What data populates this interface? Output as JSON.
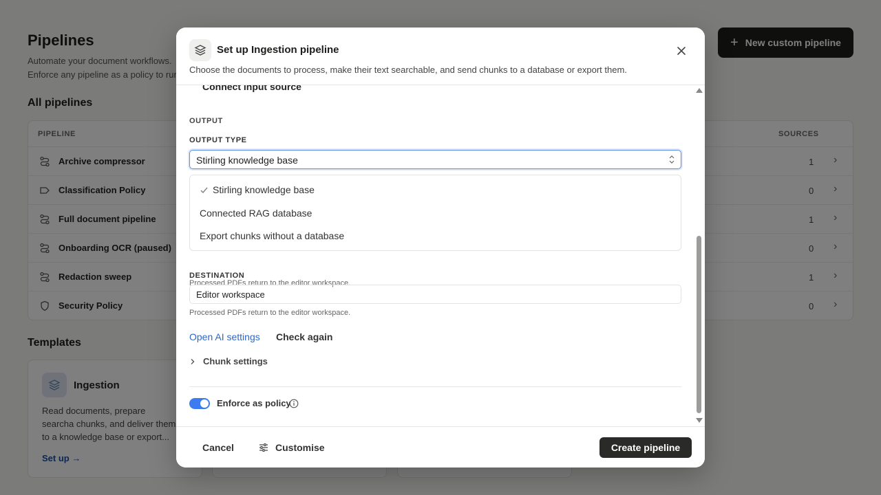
{
  "page": {
    "title": "Pipelines",
    "subtitle_lines": [
      "Automate your document workflows.",
      "Enforce any pipeline as a policy to run"
    ],
    "new_button_label": "New custom pipeline"
  },
  "all_pipelines": {
    "heading": "All pipelines",
    "columns": {
      "pipeline": "PIPELINE",
      "sources": "SOURCES"
    },
    "rows": [
      {
        "name": "Archive compressor",
        "icon": "workflow-icon",
        "sources": "1"
      },
      {
        "name": "Classification Policy",
        "icon": "tag-icon",
        "sources": "0"
      },
      {
        "name": "Full document pipeline",
        "icon": "workflow-icon",
        "sources": "1"
      },
      {
        "name": "Onboarding OCR (paused)",
        "icon": "workflow-icon",
        "sources": "0"
      },
      {
        "name": "Redaction sweep",
        "icon": "workflow-icon",
        "sources": "1"
      },
      {
        "name": "Security Policy",
        "icon": "shield-icon",
        "sources": "0"
      }
    ]
  },
  "templates": {
    "heading": "Templates",
    "ingestion": {
      "name": "Ingestion",
      "description": "Read documents, prepare searcha chunks, and deliver them to a knowledge base or export...",
      "link": "Set up"
    }
  },
  "modal": {
    "title": "Set up Ingestion pipeline",
    "description": "Choose the documents to process, make their text searchable, and send chunks to a database or export them.",
    "clipped_row": "Connect input source",
    "output_section": "OUTPUT",
    "output_type_label": "OUTPUT TYPE",
    "output_type_value": "Stirling knowledge base",
    "output_options": [
      "Stirling knowledge base",
      "Connected RAG database",
      "Export chunks without a database"
    ],
    "hint_1": "Processed PDFs return to the editor workspace.",
    "destination_label": "DESTINATION",
    "destination_value": "Editor workspace",
    "hint_2": "Processed PDFs return to the editor workspace.",
    "open_ai_settings": "Open AI settings",
    "check_again": "Check again",
    "chunk_settings": "Chunk settings",
    "enforce_policy": "Enforce as policy",
    "cancel": "Cancel",
    "customise": "Customise",
    "create": "Create pipeline"
  },
  "colors": {
    "accent": "#3d7cf0",
    "primary_button": "#2a2a28",
    "link": "#2b67c9"
  }
}
